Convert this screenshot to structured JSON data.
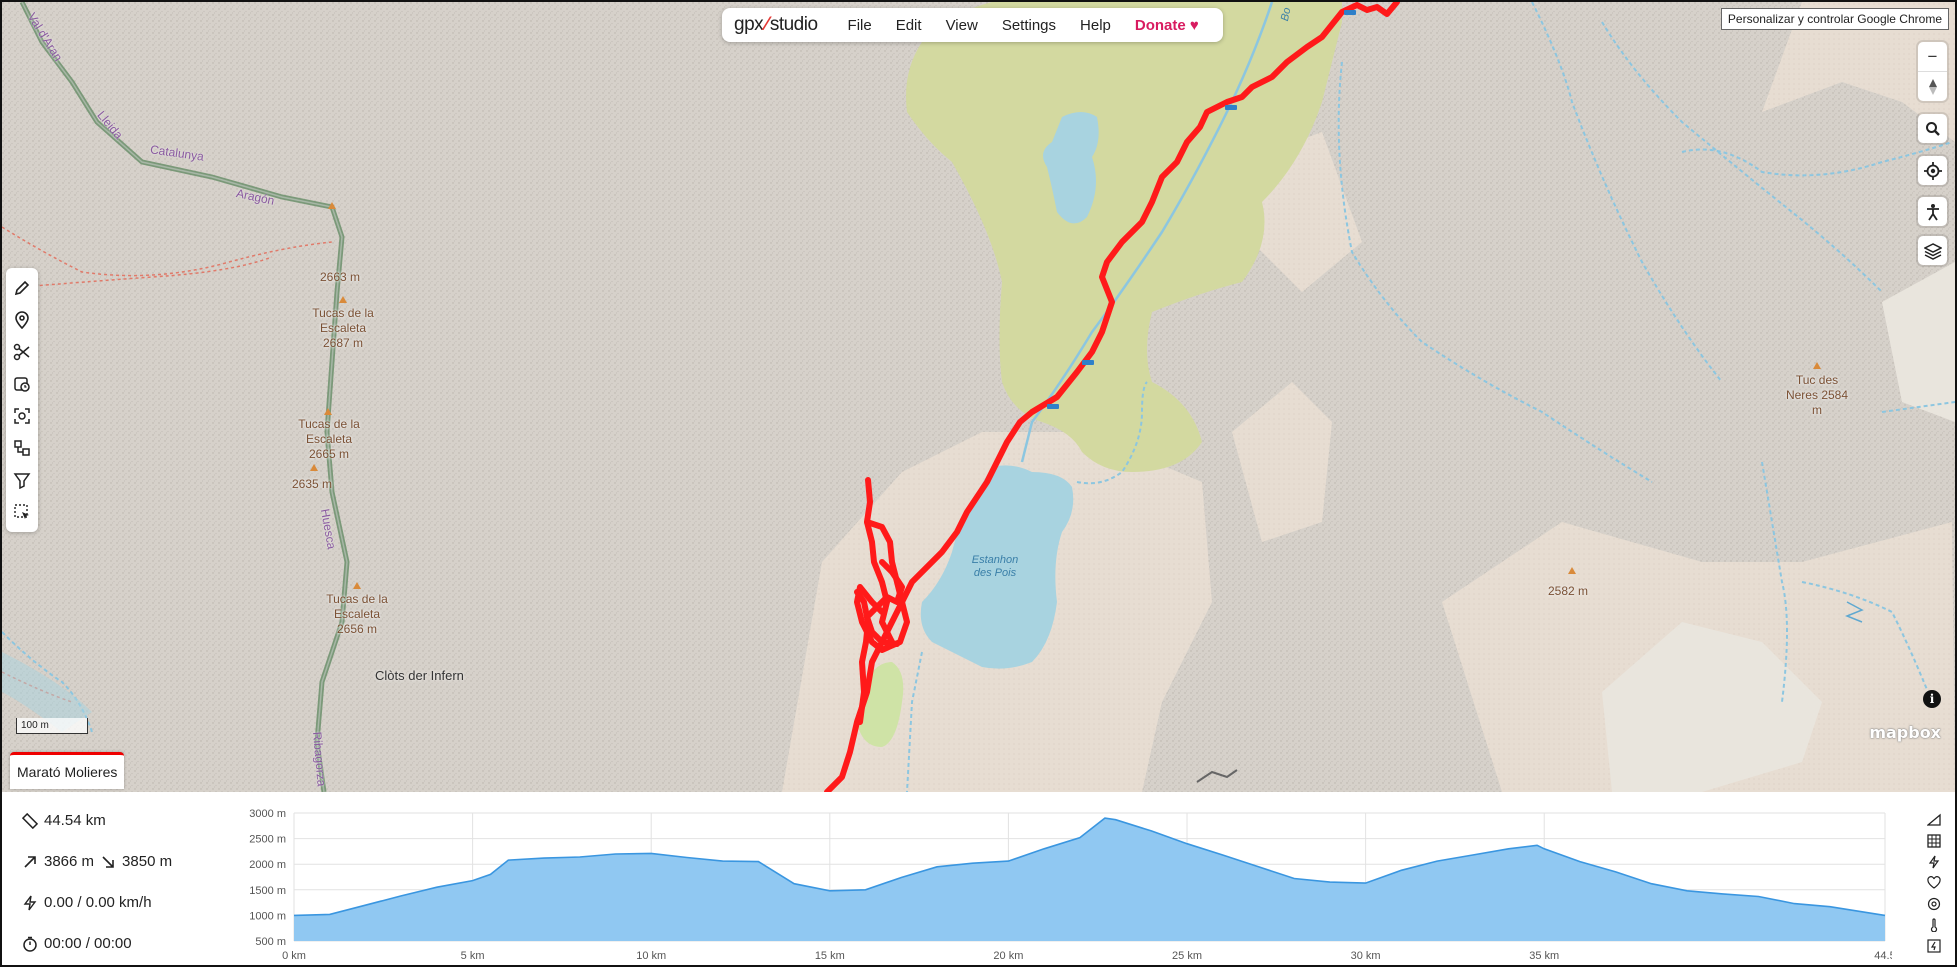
{
  "menubar": {
    "logo_left": "gpx",
    "logo_right": "studio",
    "items": [
      "File",
      "Edit",
      "View",
      "Settings",
      "Help"
    ],
    "donate": "Donate"
  },
  "chrome_tooltip": "Personalizar y controlar Google Chrome",
  "map": {
    "scale_label": "100 m",
    "mapbox_label": "mapbox",
    "admin_labels": [
      "Val d'Aran",
      "Lleida",
      "Catalunya",
      "Aragón",
      "Huesca",
      "Ribagorza"
    ],
    "peak_labels": [
      "2663 m",
      "Tucas de la Escaleta 2687 m",
      "Tucas de la Escaleta 2665 m",
      "2635 m",
      "Tucas de la Escaleta 2656 m",
      "Tuc des Neres 2584 m",
      "2582 m"
    ],
    "place_label": "Clòts der Infern",
    "lake_label": "Estanhon des Pois",
    "river_label": "Bo"
  },
  "track_tab": "Marató Molieres",
  "stats": {
    "distance": "44.54 km",
    "elevation_gain": "3866 m",
    "elevation_loss": "3850 m",
    "speed": "0.00 / 0.00 km/h",
    "time": "00:00 / 00:00"
  },
  "icons": {
    "toolbar": [
      "pencil-icon",
      "pin-icon",
      "scissors-icon",
      "clock-icon",
      "scan-icon",
      "merge-icon",
      "filter-icon",
      "select-icon"
    ],
    "map_controls": [
      "zoom-out-icon",
      "compass-icon",
      "search-icon",
      "locate-icon",
      "accessibility-icon",
      "layers-icon"
    ],
    "profile_side": [
      "slope-icon",
      "grid-icon",
      "speed-icon",
      "heart-icon",
      "cadence-icon",
      "temperature-icon",
      "power-icon"
    ]
  },
  "colors": {
    "track": "#ff1a1a",
    "elevation_fill": "#90c8f2",
    "elevation_line": "#3a96e0",
    "donate": "#d81b60"
  },
  "chart_data": {
    "type": "area",
    "title": "",
    "xlabel": "",
    "ylabel": "",
    "x_ticks": [
      "0 km",
      "5 km",
      "10 km",
      "15 km",
      "20 km",
      "25 km",
      "30 km",
      "35 km",
      "44.5"
    ],
    "y_ticks": [
      "500 m",
      "1000 m",
      "1500 m",
      "2000 m",
      "2500 m",
      "3000 m"
    ],
    "xlim": [
      0,
      44.54
    ],
    "ylim": [
      500,
      3000
    ],
    "grid": true,
    "series": [
      {
        "x": [
          0,
          1,
          2,
          3,
          4,
          5,
          5.5,
          6,
          7,
          8,
          9,
          10,
          11,
          12,
          13,
          14,
          15,
          16,
          17,
          18,
          19,
          20,
          21,
          22,
          22.7,
          23,
          24,
          25,
          26,
          27,
          28,
          29,
          30,
          31,
          32,
          33,
          34,
          34.8,
          35,
          36,
          37,
          38,
          39,
          40,
          41,
          42,
          43,
          44.54
        ],
        "y": [
          1000,
          1020,
          1200,
          1380,
          1550,
          1680,
          1800,
          2080,
          2120,
          2140,
          2200,
          2210,
          2130,
          2060,
          2050,
          1620,
          1480,
          1500,
          1740,
          1950,
          2020,
          2060,
          2300,
          2520,
          2900,
          2870,
          2650,
          2400,
          2180,
          1950,
          1720,
          1650,
          1630,
          1880,
          2060,
          2180,
          2300,
          2370,
          2300,
          2050,
          1850,
          1620,
          1480,
          1420,
          1370,
          1230,
          1170,
          1000
        ]
      }
    ]
  }
}
